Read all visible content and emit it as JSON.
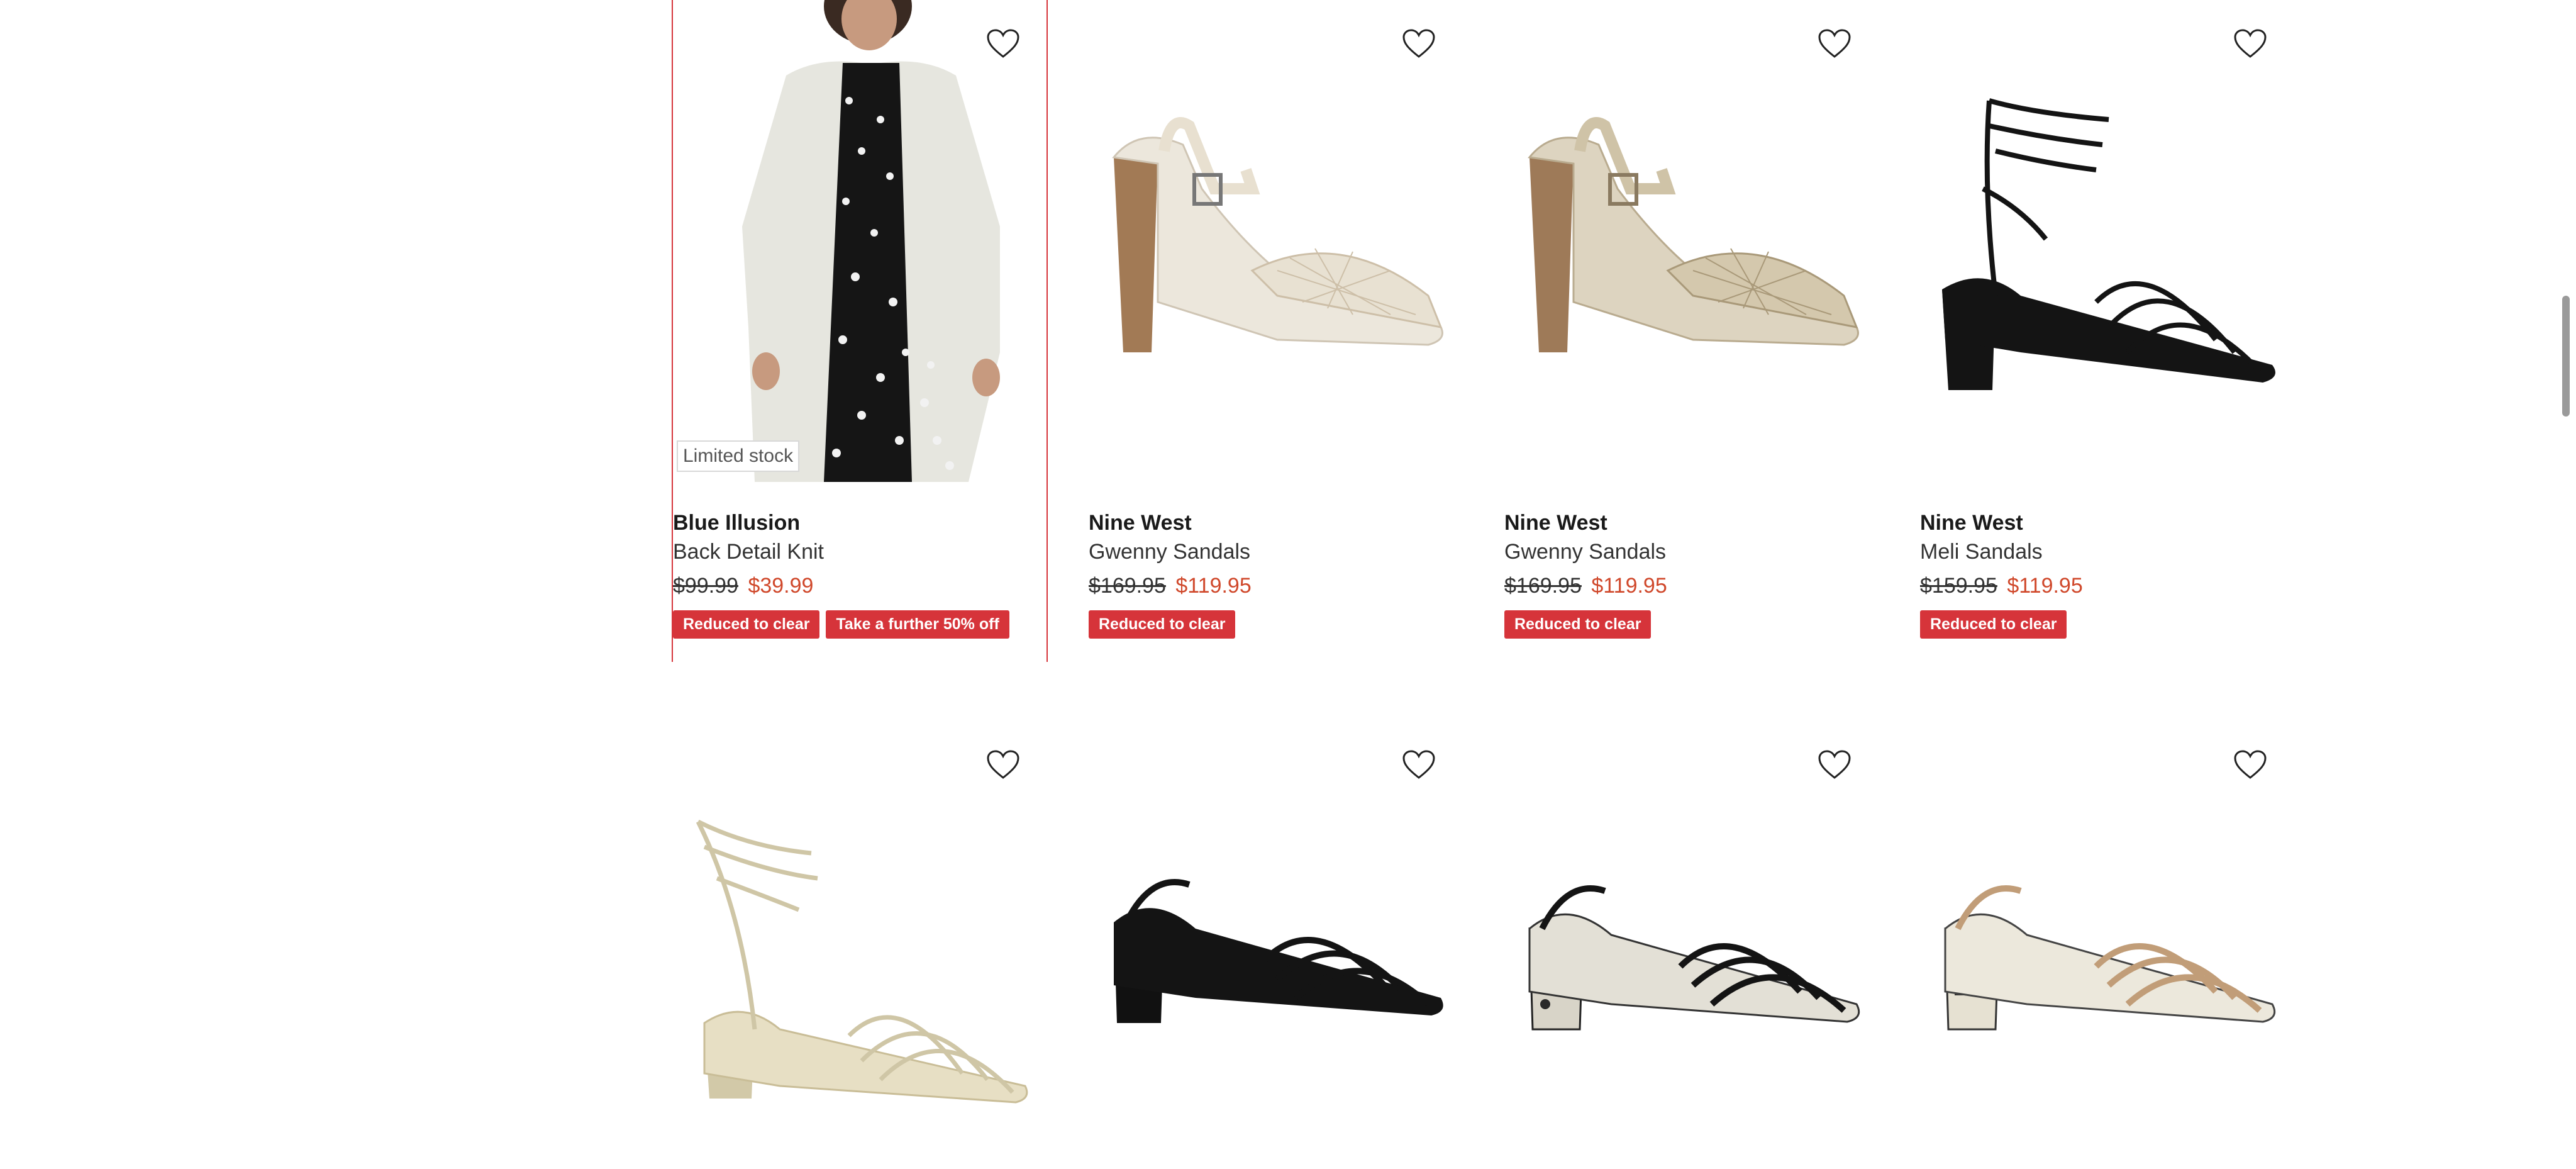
{
  "products": [
    {
      "brand": "Blue Illusion",
      "name": "Back Detail Knit",
      "was_price": "$99.99",
      "now_price": "$39.99",
      "stock_label": "Limited stock",
      "badges": [
        "Reduced to clear",
        "Take a further 50% off"
      ],
      "image": "cardigan-model-image"
    },
    {
      "brand": "Nine West",
      "name": "Gwenny Sandals",
      "was_price": "$169.95",
      "now_price": "$119.95",
      "badges": [
        "Reduced to clear"
      ],
      "image": "cream-woven-block-heel-sandal"
    },
    {
      "brand": "Nine West",
      "name": "Gwenny Sandals",
      "was_price": "$169.95",
      "now_price": "$119.95",
      "badges": [
        "Reduced to clear"
      ],
      "image": "gold-woven-block-heel-sandal"
    },
    {
      "brand": "Nine West",
      "name": "Meli Sandals",
      "was_price": "$159.95",
      "now_price": "$119.95",
      "badges": [
        "Reduced to clear"
      ],
      "image": "black-lace-up-block-heel-sandal"
    },
    {
      "image": "gold-lace-up-strappy-sandal"
    },
    {
      "image": "black-strappy-slingback-sandal"
    },
    {
      "image": "snake-print-strappy-slingback-sandal"
    },
    {
      "image": "natural-snake-print-strappy-slingback-sandal"
    }
  ],
  "icons": {
    "wishlist": "heart-outline-icon"
  },
  "colors": {
    "badge": "#d6343a",
    "sale_price": "#d0492c",
    "focus_outline": "#d6343a"
  }
}
